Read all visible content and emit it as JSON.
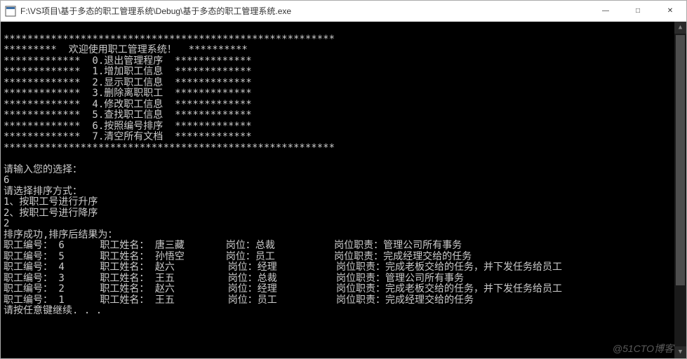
{
  "window": {
    "title": "F:\\VS项目\\基于多态的职工管理系统\\Debug\\基于多态的职工管理系统.exe"
  },
  "menu": {
    "border_top": "********************************************************",
    "header_line": "*********  欢迎使用职工管理系统！  **********",
    "items": [
      "*************  0.退出管理程序  *************",
      "*************  1.增加职工信息  *************",
      "*************  2.显示职工信息  *************",
      "*************  3.删除离职职工  *************",
      "*************  4.修改职工信息  *************",
      "*************  5.查找职工信息  *************",
      "*************  6.按照编号排序  *************",
      "*************  7.清空所有文档  *************"
    ],
    "border_bottom": "********************************************************"
  },
  "interaction": {
    "prompt1": "请输入您的选择：",
    "input1": "6",
    "prompt2": "请选择排序方式：",
    "opt1": "1、按职工号进行升序",
    "opt2": "2、按职工号进行降序",
    "input2": "2",
    "result_header": "排序成功,排序后结果为：",
    "press_any_key": "请按任意键继续. . ."
  },
  "table": {
    "rows": [
      {
        "id": "6",
        "name": "唐三藏",
        "position": "总裁",
        "duty": "管理公司所有事务"
      },
      {
        "id": "5",
        "name": "孙悟空",
        "position": "员工",
        "duty": "完成经理交给的任务"
      },
      {
        "id": "4",
        "name": "赵六",
        "position": "经理",
        "duty": "完成老板交给的任务，并下发任务给员工"
      },
      {
        "id": "3",
        "name": "王五",
        "position": "总裁",
        "duty": "管理公司所有事务"
      },
      {
        "id": "2",
        "name": "赵六",
        "position": "经理",
        "duty": "完成老板交给的任务，并下发任务给员工"
      },
      {
        "id": "1",
        "name": "王五",
        "position": "员工",
        "duty": "完成经理交给的任务"
      }
    ],
    "labels": {
      "id": "职工编号：",
      "name": "职工姓名：",
      "position": "岗位：",
      "duty": "岗位职责："
    }
  },
  "watermark": "@51CTO博客"
}
